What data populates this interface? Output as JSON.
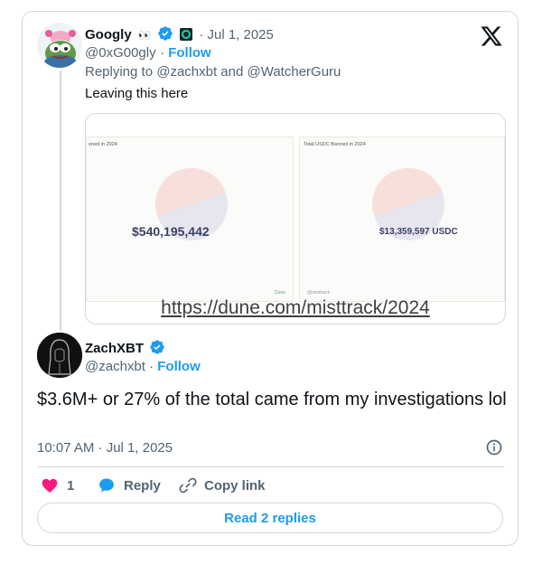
{
  "quoted_tweet": {
    "author_name": "Googly",
    "eyes_emoji": "👀",
    "dot_date": "· Jul 1, 2025",
    "handle": "@0xG00gly",
    "follow_label": "Follow",
    "replying_prefix": "Replying to ",
    "replying_user1": "@zachxbt",
    "replying_and": " and ",
    "replying_user2": "@WatcherGuru",
    "text": "Leaving this here",
    "media": {
      "left_panel_title": "oned in 2024",
      "left_panel_value": "$540,195,442",
      "left_panel_footer": "Dune",
      "right_panel_title": "Total USDC Banned in 2024",
      "right_panel_value": "$13,359,597 USDC",
      "right_panel_footer": "@misttrack",
      "url": "https://dune.com/misttrack/2024"
    }
  },
  "main_tweet": {
    "author_name": "ZachXBT",
    "handle": "@zachxbt",
    "dot_sep": " · ",
    "follow_label": "Follow",
    "text": "$3.6M+ or 27% of the total came from my investigations lol",
    "timestamp": "10:07 AM · Jul 1, 2025"
  },
  "actions": {
    "like_count": "1",
    "reply_label": "Reply",
    "copy_link_label": "Copy link",
    "read_replies_label": "Read 2 replies"
  },
  "colors": {
    "accent": "#1d9bf0",
    "like": "#f91880",
    "verified": "#1d9bf0"
  }
}
